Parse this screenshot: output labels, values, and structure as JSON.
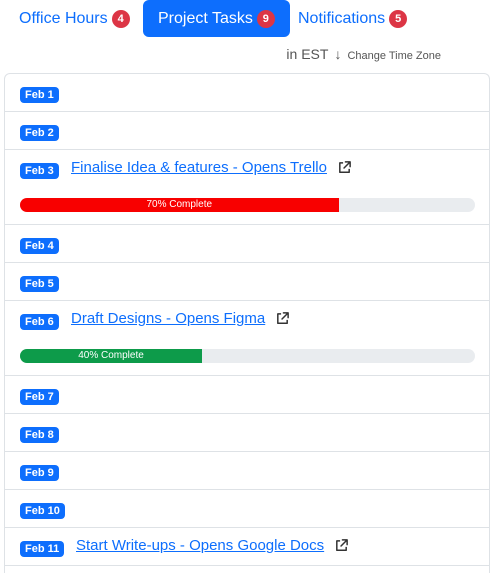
{
  "tabs": [
    {
      "label": "Office Hours",
      "count": "4"
    },
    {
      "label": "Project Tasks",
      "count": "9"
    },
    {
      "label": "Notifications",
      "count": "5"
    }
  ],
  "timezone": {
    "current": "in EST",
    "arrow": "↓",
    "change_link": "Change Time Zone"
  },
  "schedule": [
    {
      "date": "Feb 1"
    },
    {
      "date": "Feb 2"
    },
    {
      "date": "Feb 3",
      "task": "Finalise Idea & features - Opens Trello",
      "progress_label": "70% Complete",
      "progress": 70,
      "color": "#f80000"
    },
    {
      "date": "Feb 4"
    },
    {
      "date": "Feb 5"
    },
    {
      "date": "Feb 6",
      "task": "Draft Designs - Opens Figma",
      "progress_label": "40% Complete",
      "progress": 40,
      "color": "#0d9b4a"
    },
    {
      "date": "Feb 7"
    },
    {
      "date": "Feb 8"
    },
    {
      "date": "Feb 9"
    },
    {
      "date": "Feb 10"
    },
    {
      "date": "Feb 11",
      "task": "Start Write-ups - Opens Google Docs"
    }
  ],
  "colors": {
    "primary": "#0d6efd",
    "badge": "#dc3545"
  }
}
